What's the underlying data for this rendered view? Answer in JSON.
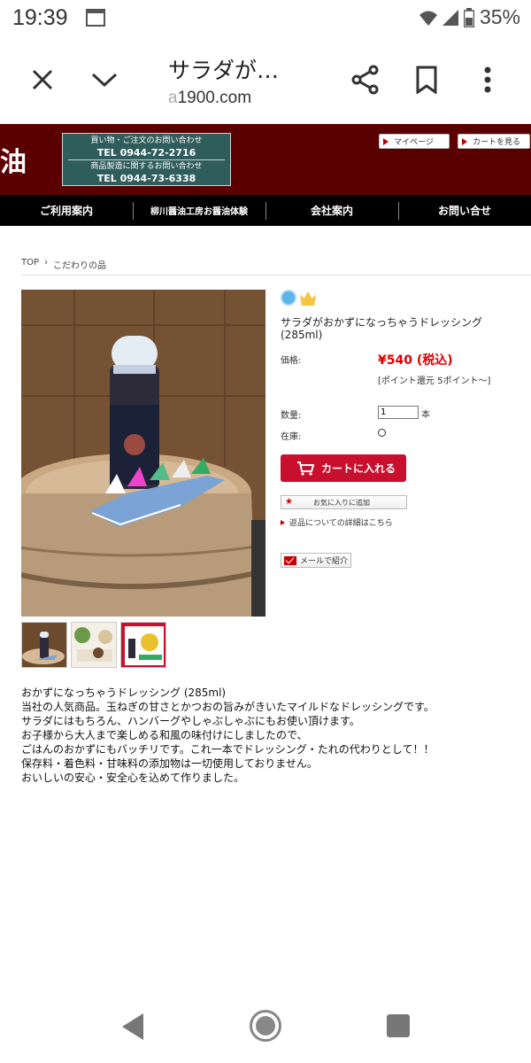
{
  "status_bar": {
    "time": "19:39",
    "battery": "35%"
  },
  "browser": {
    "title": "サラダが…",
    "url_dim": "a",
    "url_main": "1900.com"
  },
  "header": {
    "logo_fragment": "油",
    "contact": {
      "shop_heading": "買い物・ご注文のお問い合わせ",
      "shop_tel": "TEL 0944-72-2716",
      "mfg_heading": "商品製造に関するお問い合わせ",
      "mfg_tel": "TEL 0944-73-6338"
    },
    "mypage_label": "マイページ",
    "cart_label": "カートを見る"
  },
  "nav": {
    "items": [
      "ご利用案内",
      "柳川醤油工房お醤油体験",
      "会社案内",
      "お問い合せ"
    ]
  },
  "breadcrumb": {
    "top": "TOP",
    "sep": "›",
    "current": "こだわりの品"
  },
  "product": {
    "name": "サラダがおかずになっちゃうドレッシング(285ml)",
    "price_label": "価格:",
    "price": "¥540 (税込)",
    "points": "[ポイント還元 5ポイント〜]",
    "qty_label": "数量:",
    "qty_value": "1",
    "qty_unit": "本",
    "stock_label": "在庫:",
    "cart_button": "カートに入れる",
    "favorite_button": "お気に入りに追加",
    "returns_link": "返品についての詳細はこちら",
    "mail_button": "メールで紹介"
  },
  "description": {
    "lines": [
      "おかずになっちゃうドレッシング (285ml)",
      "当社の人気商品。玉ねぎの甘さとかつおの旨みがきいたマイルドなドレッシングです。",
      "サラダにはもちろん、ハンバーグやしゃぶしゃぶにもお使い頂けます。",
      "お子様から大人まで楽しめる和風の味付けにしましたので、",
      "ごはんのおかずにもバッチリです。これ一本でドレッシング・たれの代わりとして！！",
      "保存料・着色料・甘味料の添加物は一切使用しておりません。",
      "おいしいの安心・安全心を込めて作りました。"
    ]
  },
  "colors": {
    "header_bg": "#5a0000",
    "contact_bg": "#2f5d5b",
    "price": "#dd0000",
    "cart_button": "#c8102e"
  },
  "icons": [
    "close-icon",
    "chevron-down-icon",
    "share-icon",
    "bookmark-icon",
    "more-vert-icon",
    "cart-icon",
    "star-icon",
    "mail-icon",
    "wifi-icon",
    "signal-icon",
    "battery-icon",
    "calendar-icon"
  ]
}
